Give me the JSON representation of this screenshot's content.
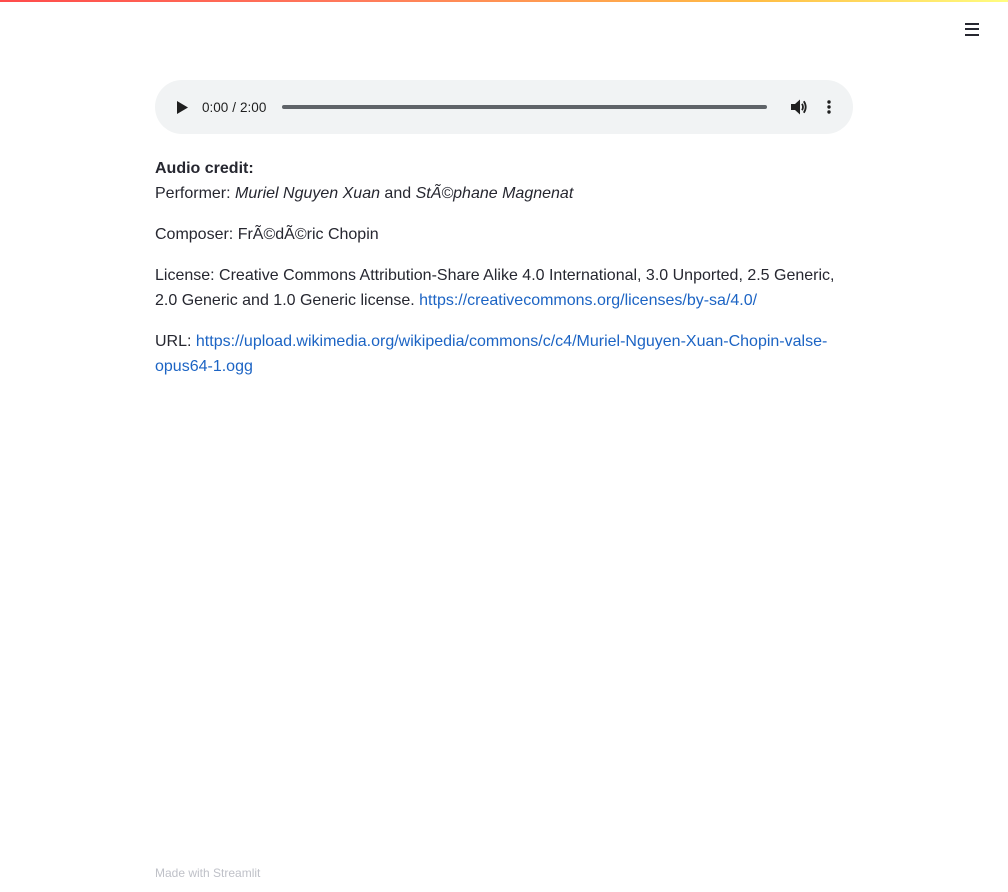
{
  "header": {
    "menu_icon": "hamburger-menu-icon"
  },
  "audio": {
    "play_icon": "play-icon",
    "current_time": "0:00",
    "separator": "/",
    "duration": "2:00",
    "progress": 0,
    "volume_icon": "volume-icon",
    "more_icon": "more-vertical-icon",
    "colors": {
      "background": "#f1f3f4",
      "track": "#5f6368"
    }
  },
  "credits": {
    "heading": "Audio credit:",
    "performer_label": "Performer: ",
    "performer_1": "Muriel Nguyen Xuan",
    "performer_joiner": " and ",
    "performer_2": "StÃ©phane Magnenat",
    "composer_label": "Composer: ",
    "composer": "FrÃ©dÃ©ric Chopin",
    "license_label": "License: ",
    "license_text": "Creative Commons Attribution-Share Alike 4.0 International, 3.0 Unported, 2.5 Generic, 2.0 Generic and 1.0 Generic license.",
    "license_url": "https://creativecommons.org/licenses/by-sa/4.0/",
    "url_label": "URL: ",
    "url": "https://upload.wikimedia.org/wikipedia/commons/c/c4/Muriel-Nguyen-Xuan-Chopin-valse-opus64-1.ogg"
  },
  "footer": {
    "made_with": "Made with ",
    "brand": "Streamlit"
  },
  "colors": {
    "text": "#262730",
    "link": "#1c64c4",
    "footer": "#bfc1c8",
    "gradient_start": "#ff4b4b",
    "gradient_end": "#fffd80"
  }
}
